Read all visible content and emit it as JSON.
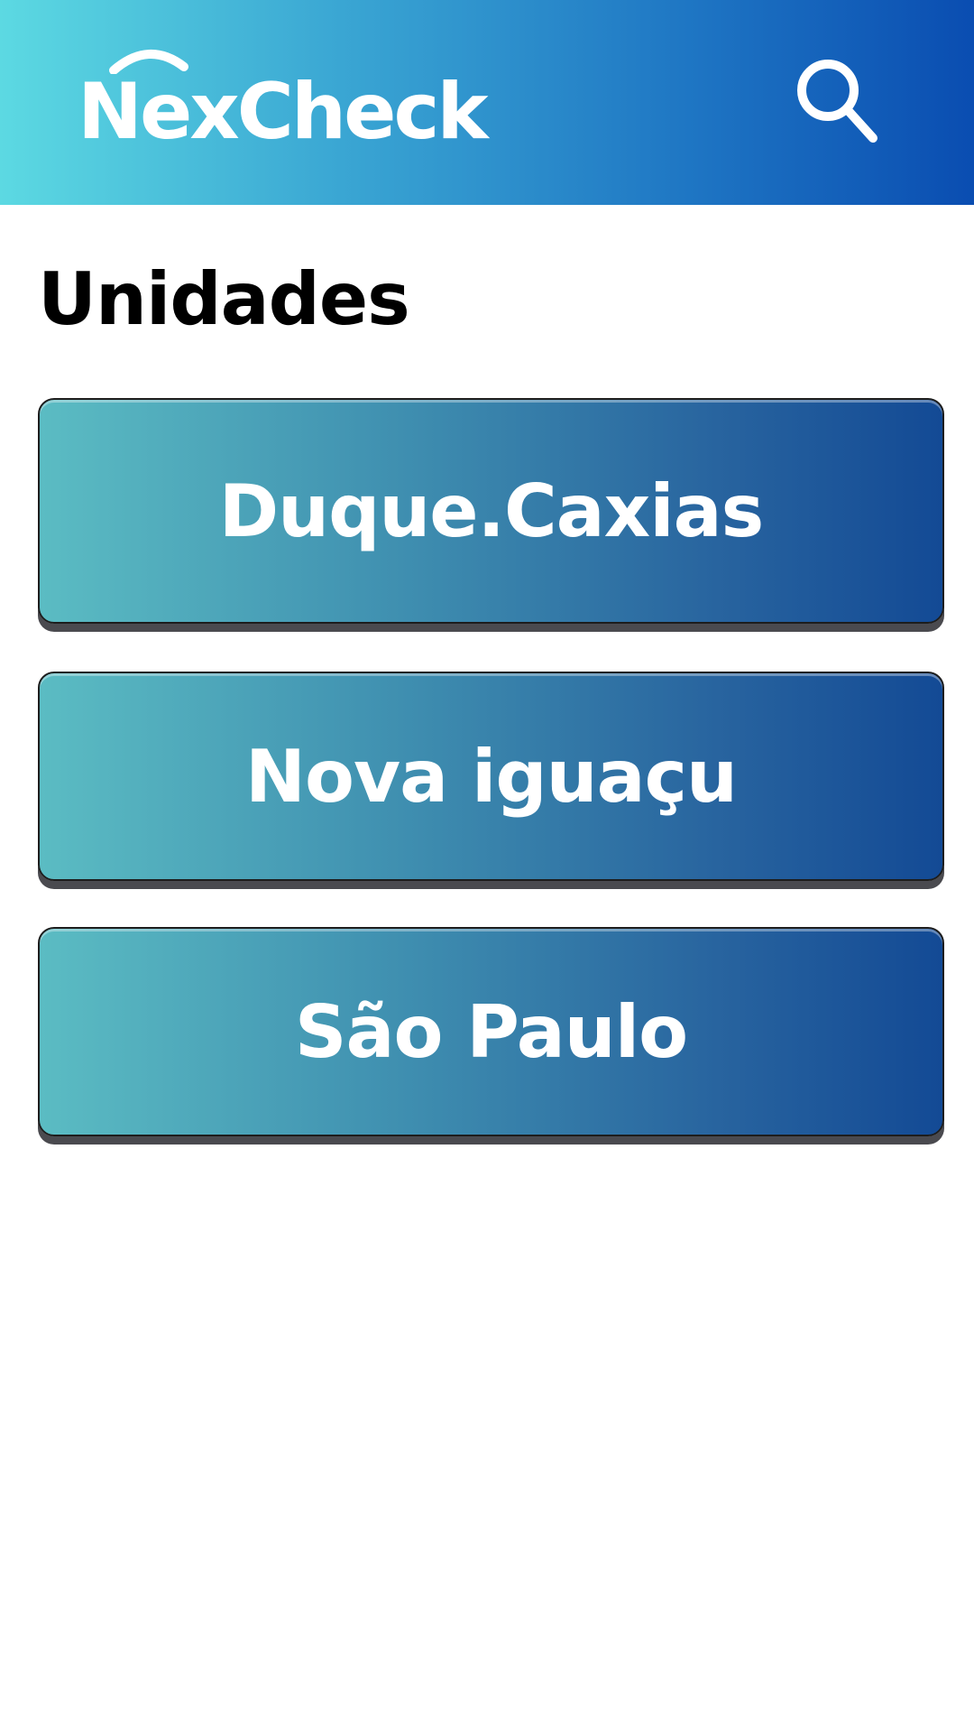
{
  "header": {
    "logo_text": "NexCheck",
    "search_icon": "search-icon",
    "gradient_start": "#5cd9e2",
    "gradient_end": "#0a4db1"
  },
  "main": {
    "title": "Unidades",
    "units": [
      {
        "label": "Duque.Caxias"
      },
      {
        "label": "Nova iguaçu"
      },
      {
        "label": "São Paulo"
      }
    ],
    "button_gradient_start": "#5bbcc3",
    "button_gradient_end": "#134a95"
  }
}
